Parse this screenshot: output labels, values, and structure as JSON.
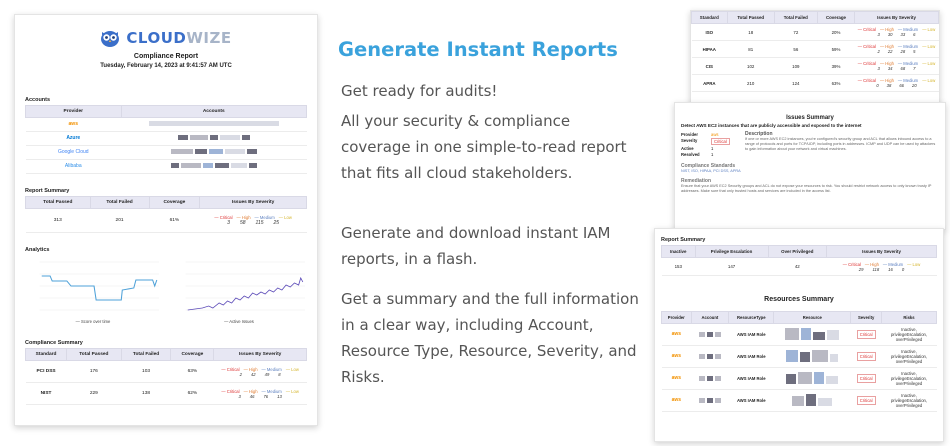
{
  "report": {
    "brand": "CLOUDWIZE",
    "brand_a": "CLOUD",
    "brand_b": "WIZE",
    "title": "Compliance Report",
    "date": "Tuesday, February 14, 2023 at 9:41:57 AM UTC",
    "accounts_title": "Accounts",
    "accounts_headers": [
      "Provider",
      "Accounts"
    ],
    "provider_labels": [
      "aws",
      "Azure",
      "Google Cloud",
      "Alibaba"
    ],
    "summary_title": "Report Summary",
    "summary_headers": [
      "Total Passed",
      "Total Failed",
      "Coverage",
      "Issues By Severity"
    ],
    "summary_row": [
      "313",
      "201",
      "61%"
    ],
    "severity_labels": [
      "Critical",
      "High",
      "Medium",
      "Low"
    ],
    "summary_sev": [
      "3",
      "58",
      "115",
      "25"
    ],
    "analytics_title": "Analytics",
    "chart1_legend": "— Score over time",
    "chart2_legend": "— Active Issues",
    "compliance_title": "Compliance Summary",
    "compliance_headers": [
      "Standard",
      "Total Passed",
      "Total Failed",
      "Coverage",
      "Issues By Severity"
    ],
    "compliance_rows": [
      {
        "standard": "PCI DSS",
        "passed": "176",
        "failed": "103",
        "coverage": "63%",
        "sev": [
          "2",
          "42",
          "49",
          "8"
        ]
      },
      {
        "standard": "NIST",
        "passed": "229",
        "failed": "138",
        "coverage": "62%",
        "sev": [
          "3",
          "46",
          "76",
          "13"
        ]
      }
    ]
  },
  "marketing": {
    "headline": "Generate Instant Reports",
    "p1": "Get ready for audits!",
    "p2": "All your security & compliance coverage in one simple-to-read report that fits all cloud stakeholders.",
    "p3": "Generate and download instant IAM reports, in a flash.",
    "p4": "Get a summary and the full information in a clear way, including Account, Resource Type, Resource, Severity, and Risks."
  },
  "standards_card": {
    "headers": [
      "Standard",
      "Total Passed",
      "Total Failed",
      "Coverage",
      "Issues By Severity"
    ],
    "rows": [
      {
        "standard": "ISO",
        "passed": "18",
        "failed": "72",
        "coverage": "20%",
        "sev": [
          "3",
          "30",
          "33",
          "6"
        ]
      },
      {
        "standard": "HIPAA",
        "passed": "81",
        "failed": "56",
        "coverage": "59%",
        "sev": [
          "2",
          "22",
          "28",
          "5"
        ]
      },
      {
        "standard": "CIS",
        "passed": "102",
        "failed": "109",
        "coverage": "39%",
        "sev": [
          "3",
          "34",
          "68",
          "7"
        ]
      },
      {
        "standard": "APRA",
        "passed": "210",
        "failed": "124",
        "coverage": "63%",
        "sev": [
          "0",
          "38",
          "66",
          "20"
        ]
      }
    ]
  },
  "issues_card": {
    "title": "Issues Summary",
    "subtitle": "Detect AWS EC2 instances that are publicly accessible and exposed to the internet",
    "fields": [
      {
        "k": "Provider",
        "v": "aws"
      },
      {
        "k": "Severity",
        "v": "Critical"
      },
      {
        "k": "Active",
        "v": "1"
      },
      {
        "k": "Resolved",
        "v": "1"
      }
    ],
    "desc_label": "Description",
    "desc": "If one or more AWS EC2 instances, you're configured's security group and ACL that allows inbound access to a range of protocols and ports for TCP/UDP, including ports in addresses. ICMP and UDP can be used by attackers to gain information about your network and virtual machines.",
    "standards_label": "Compliance Standards",
    "standards": "NIST, ISO, HIPAA, PCI DSS, APRA",
    "remediation_label": "Remediation",
    "remediation": "Ensure that your AWS EC2 Security groups and ACL do not expose your resources to risk. You should restrict network access to only known trusty IP addresses. Make sure that only trusted hosts and services are included in the access list."
  },
  "iam_card": {
    "summary_title": "Report Summary",
    "summary_headers": [
      "Inactive",
      "Privilege Escalation",
      "Over Privileged",
      "Issues By Severity"
    ],
    "summary_row": [
      "153",
      "147",
      "42"
    ],
    "summary_sev": [
      "29",
      "118",
      "16",
      "0"
    ],
    "resources_title": "Resources Summary",
    "resources_headers": [
      "Provider",
      "Account",
      "ResourceType",
      "Resource",
      "Severity",
      "Risks"
    ],
    "resources_rows": [
      {
        "type": "AWS IAM Role",
        "severity": "Critical",
        "risks": "Inactive, privilegeEscalation, overPrivileged"
      },
      {
        "type": "AWS IAM Role",
        "severity": "Critical",
        "risks": "Inactive, privilegeEscalation, overPrivileged"
      },
      {
        "type": "AWS IAM Role",
        "severity": "Critical",
        "risks": "Inactive, privilegeEscalation, overPrivileged"
      },
      {
        "type": "AWS IAM Role",
        "severity": "Critical",
        "risks": "Inactive, privilegeEscalation, overPrivileged"
      }
    ]
  },
  "colors": {
    "brand": "#3b6fc9",
    "accent": "#3aa2dc",
    "critical": "#d33",
    "chart_line1": "#4ea1d8",
    "chart_line2": "#5c4bb8"
  }
}
